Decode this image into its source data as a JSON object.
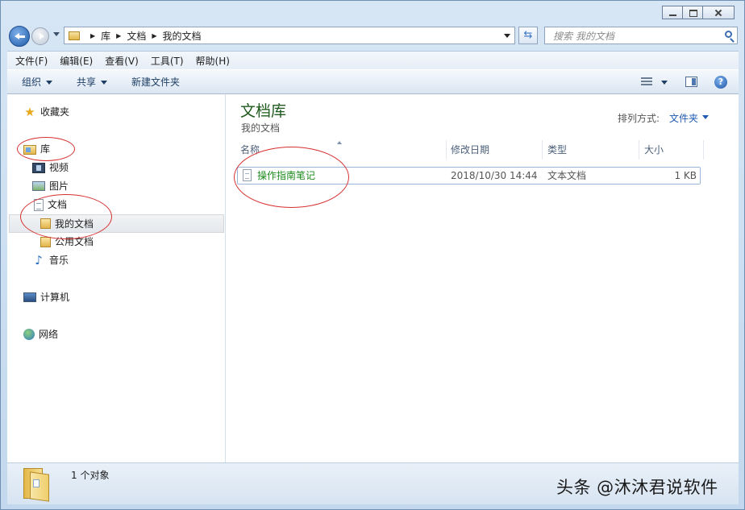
{
  "address": {
    "crumbs": [
      "库",
      "文档",
      "我的文档"
    ]
  },
  "search": {
    "placeholder": "搜索 我的文档"
  },
  "menu": [
    "文件(F)",
    "编辑(E)",
    "查看(V)",
    "工具(T)",
    "帮助(H)"
  ],
  "toolbar": {
    "organize": "组织",
    "share": "共享",
    "new_folder": "新建文件夹"
  },
  "nav": {
    "favorites": "收藏夹",
    "libraries": "库",
    "videos": "视频",
    "pictures": "图片",
    "documents": "文档",
    "my_documents": "我的文档",
    "public_documents": "公用文档",
    "music": "音乐",
    "computer": "计算机",
    "network": "网络"
  },
  "library": {
    "title": "文档库",
    "subtitle": "我的文档",
    "arrange_label": "排列方式:",
    "arrange_value": "文件夹"
  },
  "columns": {
    "name": "名称",
    "date": "修改日期",
    "type": "类型",
    "size": "大小"
  },
  "files": [
    {
      "name": "操作指南笔记",
      "date": "2018/10/30 14:44",
      "type": "文本文档",
      "size": "1 KB"
    }
  ],
  "status": {
    "count": "1 个对象"
  },
  "watermark": "头条 @沐沐君说软件"
}
